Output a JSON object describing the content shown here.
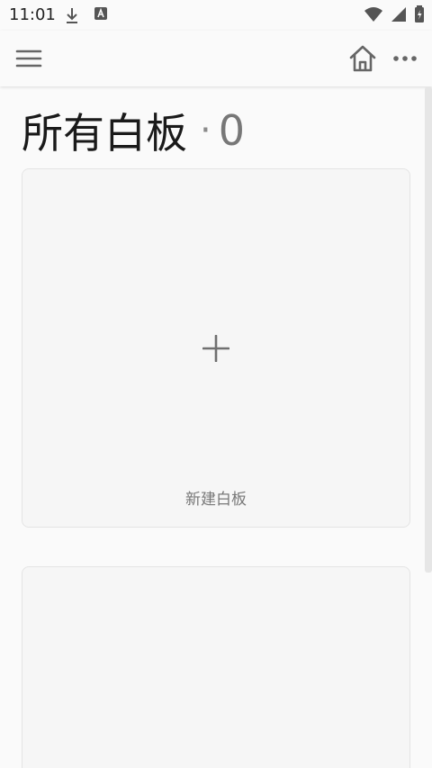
{
  "status_bar": {
    "time": "11:01",
    "icons": [
      "download-icon",
      "a-notification-icon",
      "wifi-icon",
      "signal-icon",
      "battery-icon"
    ]
  },
  "toolbar": {
    "menu_icon": "menu-icon",
    "home_icon": "home-icon",
    "more_icon": "more-icon"
  },
  "page": {
    "title": "所有白板",
    "separator": "·",
    "count": "0"
  },
  "cards": {
    "new_board_label": "新建白板",
    "plus_icon": "plus-icon"
  },
  "colors": {
    "background": "#fafafa",
    "card_background": "#f6f6f6",
    "card_border": "#e4e4e4",
    "icon_gray": "#666666",
    "title_text": "#1a1a1a"
  }
}
